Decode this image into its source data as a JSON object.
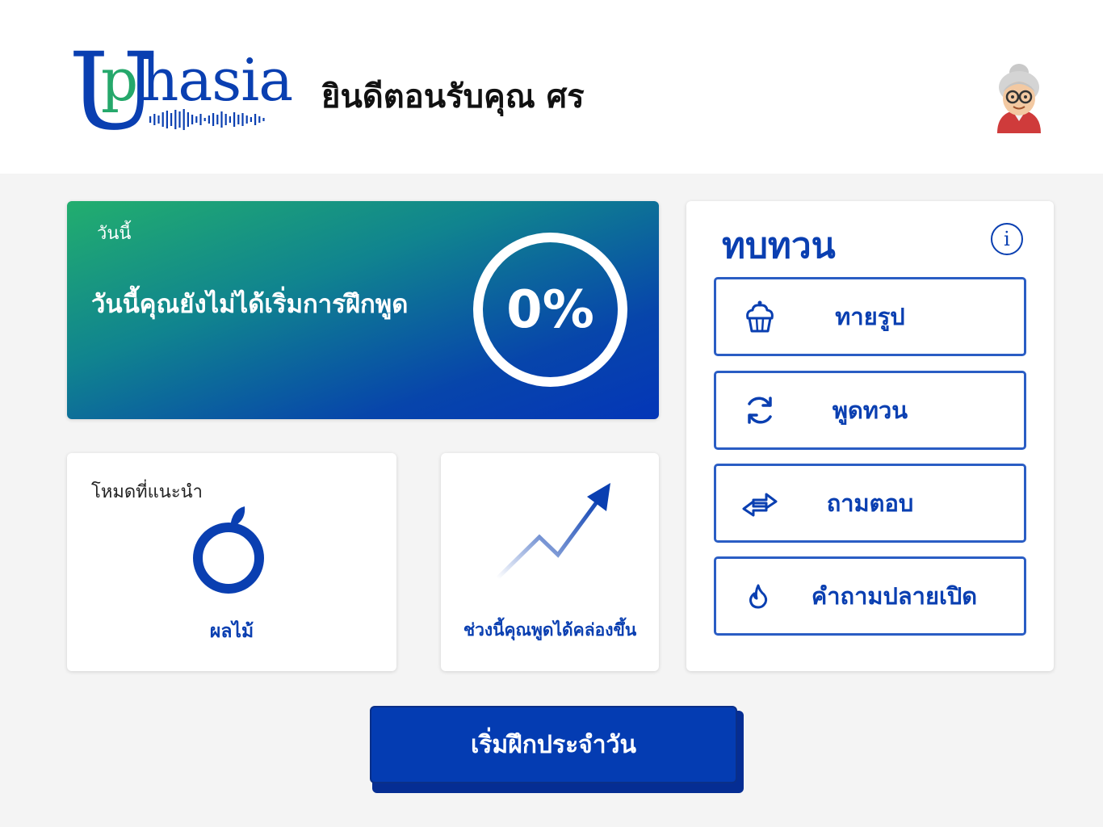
{
  "header": {
    "logo": {
      "first_letter": "U",
      "second_letter": "p",
      "rest": "hasia"
    },
    "welcome_text": "ยินดีตอนรับคุณ ศร",
    "avatar_icon": "grandmother-avatar-icon"
  },
  "today": {
    "label": "วันนี้",
    "message": "วันนี้คุณยังไม่ได้เริ่มการฝึกพูด",
    "progress_text": "0%",
    "progress_fraction": 0
  },
  "recommended": {
    "label": "โหมดที่แนะนำ",
    "icon": "fruit-icon",
    "mode_name": "ผลไม้"
  },
  "trend": {
    "icon": "trend-up-arrow-icon",
    "text": "ช่วงนี้คุณพูดได้คล่องขึ้น"
  },
  "review": {
    "title": "ทบทวน",
    "info_icon": "info-icon",
    "items": [
      {
        "label": "ทายรูป",
        "icon": "cupcake-icon"
      },
      {
        "label": "พูดทวน",
        "icon": "refresh-icon"
      },
      {
        "label": "ถามตอบ",
        "icon": "swap-arrows-icon"
      },
      {
        "label": "คำถามปลายเปิด",
        "icon": "flame-icon"
      }
    ]
  },
  "start_button": {
    "label": "เริ่มฝึกประจำวัน"
  },
  "colors": {
    "primary_blue": "#0a3fb1",
    "brand_green": "#25a86b",
    "gradient_start": "#22ae6e",
    "gradient_end": "#0436b8",
    "background": "#f4f4f4"
  }
}
